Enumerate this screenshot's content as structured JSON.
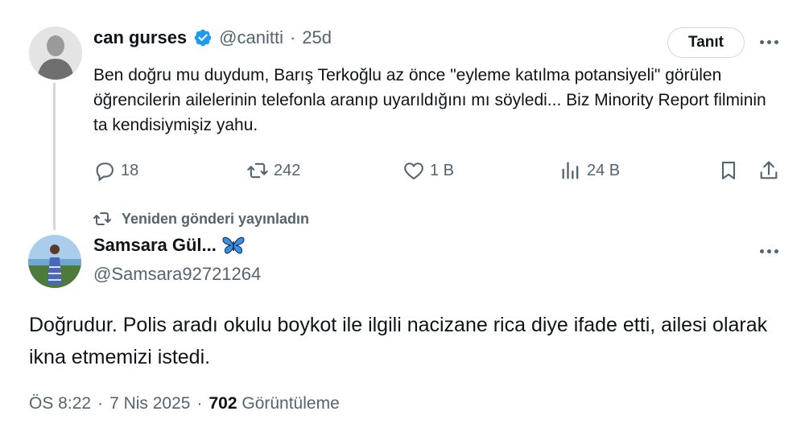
{
  "original": {
    "name": "can gurses",
    "handle": "@canitti",
    "separator": "·",
    "time": "25d",
    "follow_label": "Tanıt",
    "text": "Ben doğru mu duydum, Barış Terkoğlu az önce \"eyleme katılma potansiyeli\" görülen öğrencilerin ailelerinin telefonla aranıp uyarıldığını mı söyledi... Biz Minority Report filminin ta kendisiymişiz yahu.",
    "stats": {
      "replies": "18",
      "reposts": "242",
      "likes": "1 B",
      "views": "24 B"
    }
  },
  "repost_note": "Yeniden gönderi yayınladın",
  "reply": {
    "name": "Samsara Gül...",
    "emoji": "🦋",
    "handle": "@Samsara92721264",
    "text": "Doğrudur. Polis aradı okulu boykot ile ilgili  nacizane rica diye ifade etti, ailesi olarak ikna etmemizi istedi."
  },
  "meta": {
    "time": "ÖS 8:22",
    "sep1": "·",
    "date": "7 Nis 2025",
    "sep2": "·",
    "views_count": "702",
    "views_label": "Görüntüleme"
  },
  "colors": {
    "verified": "#1d9bf0",
    "muted": "#536471",
    "text": "#0f1419",
    "thread_line": "#cfd9de"
  }
}
